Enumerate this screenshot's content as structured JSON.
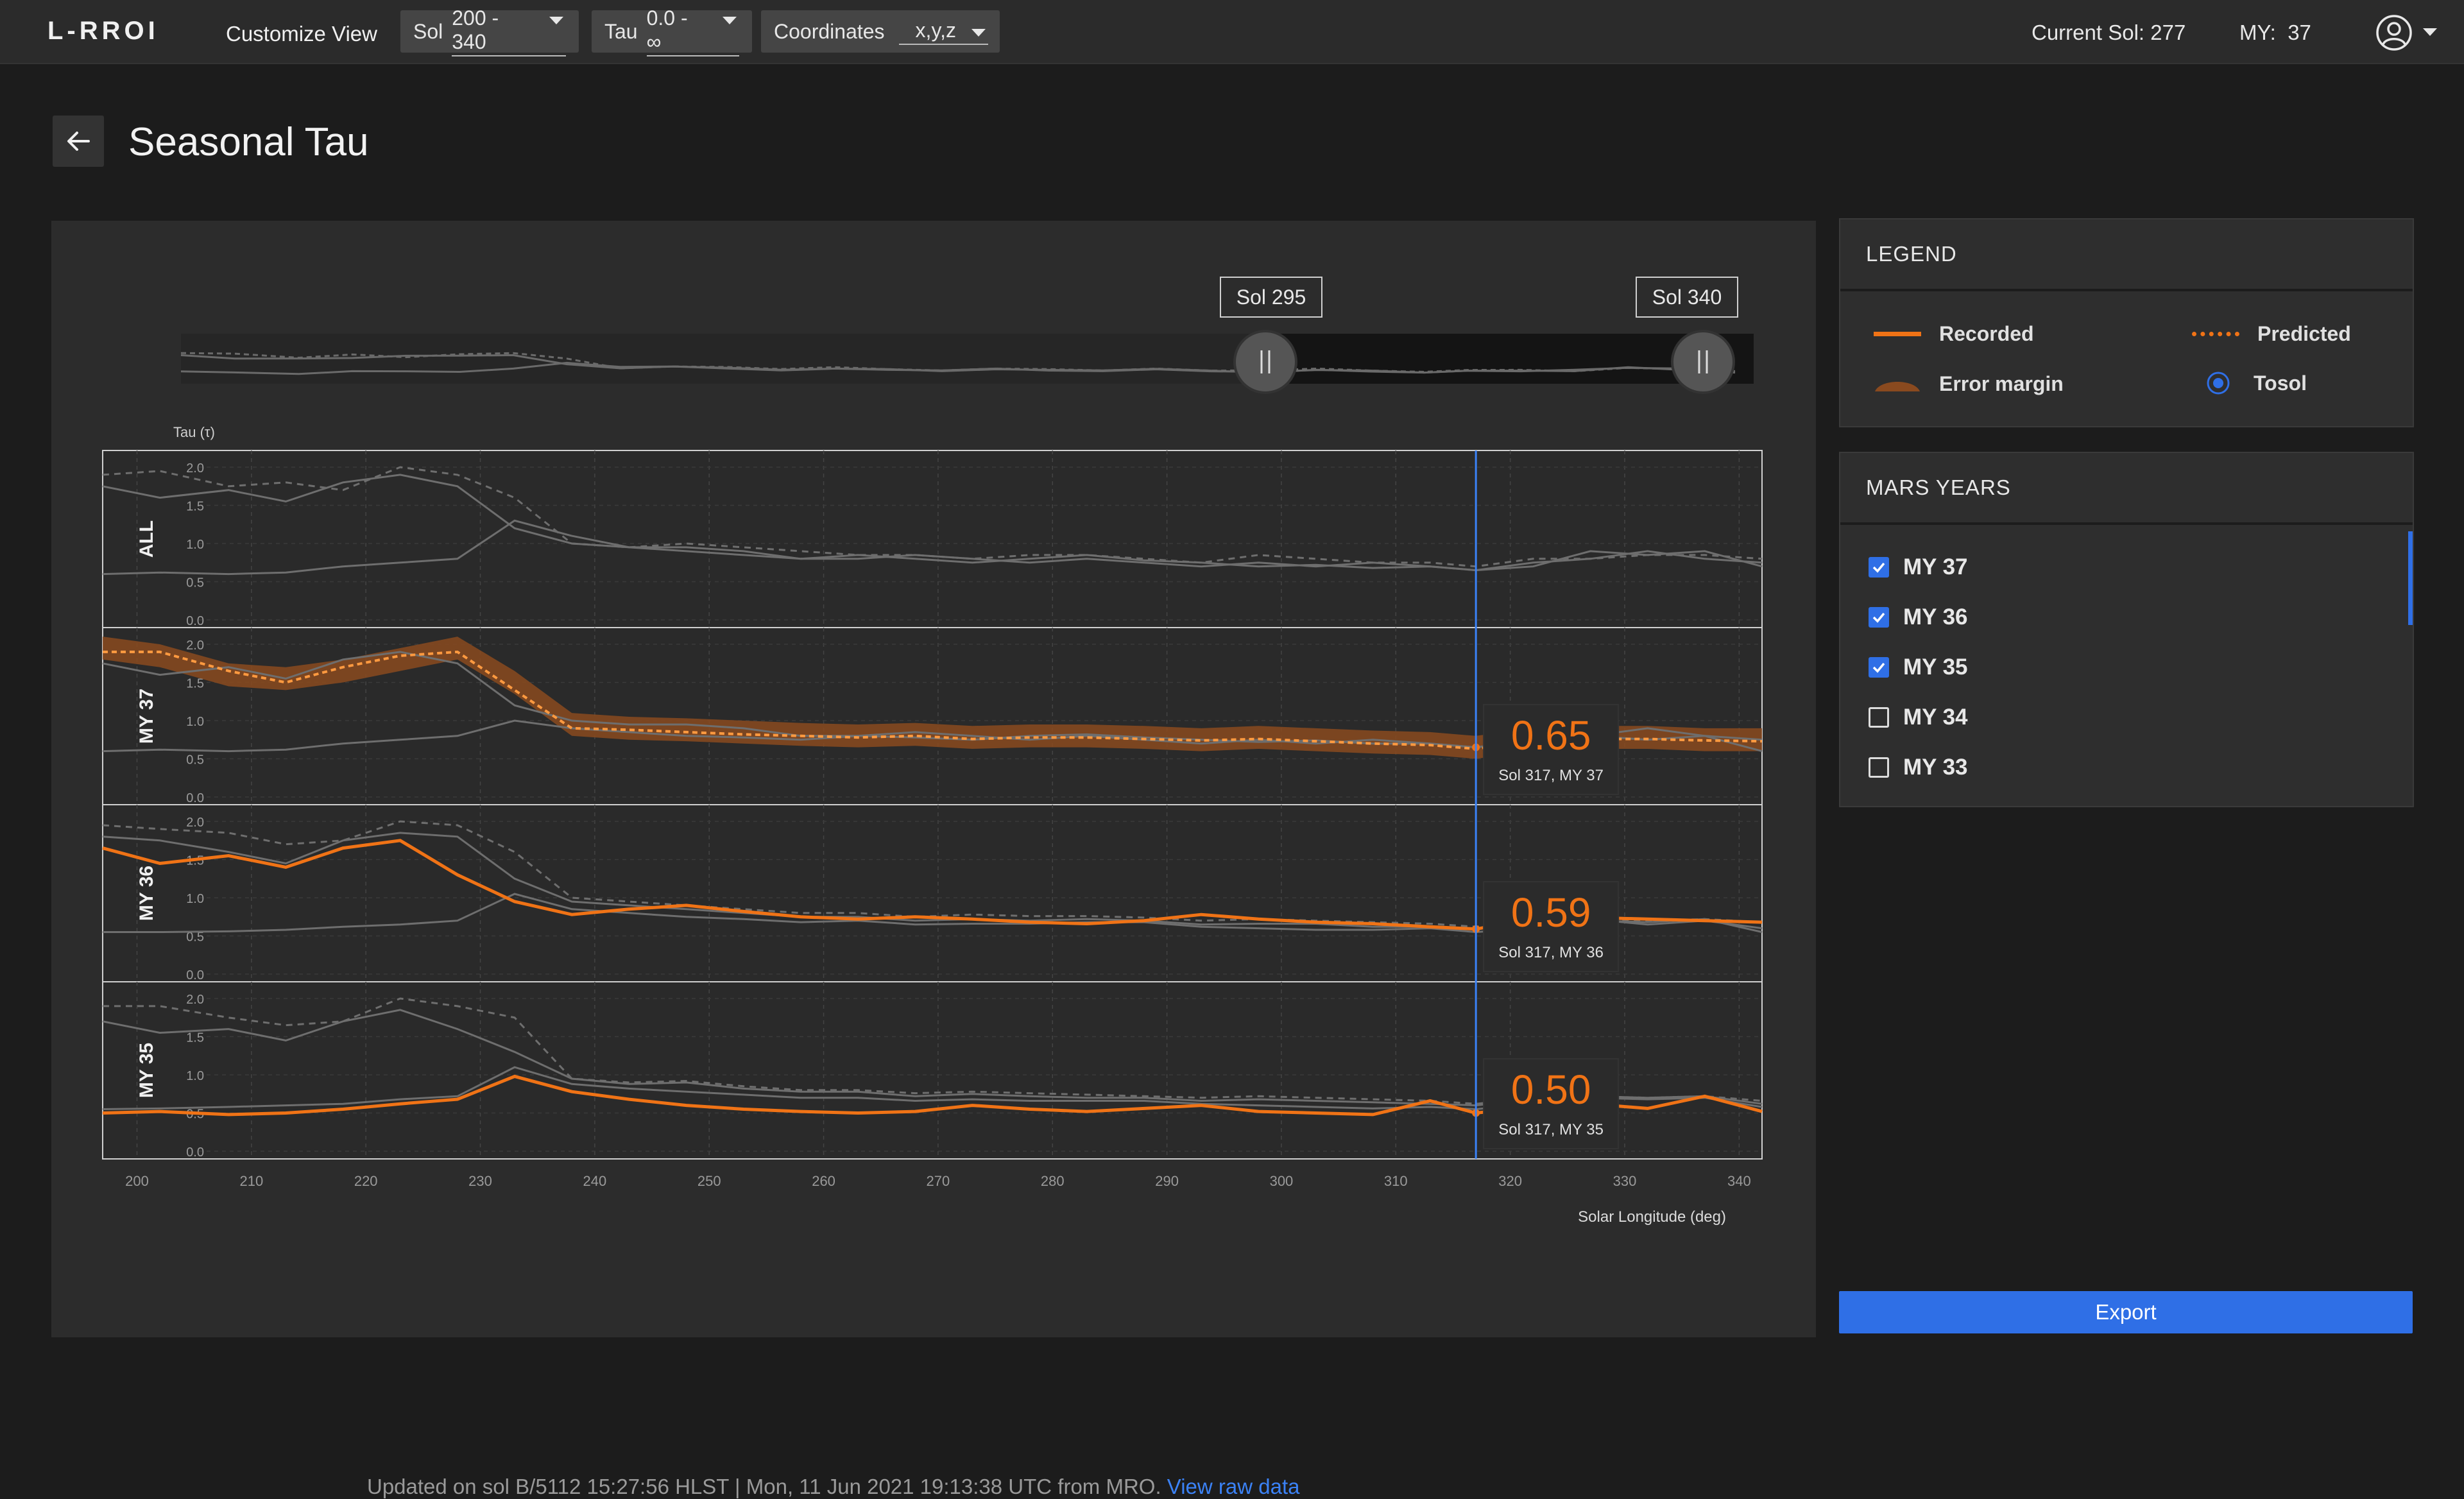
{
  "app": {
    "name": "L-RROI",
    "customize_label": "Customize View"
  },
  "filters": {
    "sol": {
      "label": "Sol",
      "value": "200 - 340"
    },
    "tau": {
      "label": "Tau",
      "value": "0.0 - ∞"
    },
    "coords": {
      "label": "Coordinates",
      "value": "x,y,z"
    }
  },
  "status": {
    "current_sol_label": "Current Sol:",
    "current_sol": "277",
    "my_label": "MY:",
    "my": "37"
  },
  "page": {
    "title": "Seasonal Tau"
  },
  "range": {
    "start": "Sol 295",
    "end": "Sol 340"
  },
  "legend": {
    "title": "LEGEND",
    "recorded": "Recorded",
    "predicted": "Predicted",
    "error": "Error margin",
    "tosol": "Tosol"
  },
  "mars_years": {
    "title": "MARS YEARS",
    "items": [
      {
        "label": "MY 37",
        "checked": true
      },
      {
        "label": "MY 36",
        "checked": true
      },
      {
        "label": "MY 35",
        "checked": true
      },
      {
        "label": "MY 34",
        "checked": false
      },
      {
        "label": "MY 33",
        "checked": false
      }
    ]
  },
  "footer": {
    "text": "Updated on sol B/5112 15:27:56 HLST | Mon, 11 Jun 2021 19:13:38 UTC from MRO.",
    "link": "View raw data"
  },
  "export_label": "Export",
  "colors": {
    "recorded": "#f07316",
    "error": "#8a4a1f",
    "cursor": "#3b82f6",
    "accent": "#2f6fe6"
  },
  "chart_data": {
    "type": "line",
    "ylabel": "Tau (τ)",
    "xlabel": "Solar Longitude (deg)",
    "x_ticks": [
      200,
      210,
      220,
      230,
      240,
      250,
      260,
      270,
      280,
      290,
      300,
      310,
      320,
      330,
      340
    ],
    "y_ticks": [
      "2.0",
      "1.5",
      "1.0",
      "0.5",
      "0.0"
    ],
    "ylim": [
      0,
      2
    ],
    "xlim": [
      197,
      342
    ],
    "cursor_x": 317,
    "x": [
      197,
      202,
      208,
      213,
      218,
      223,
      228,
      233,
      238,
      243,
      248,
      253,
      258,
      263,
      268,
      273,
      278,
      283,
      288,
      293,
      298,
      303,
      308,
      313,
      317,
      322,
      327,
      332,
      337,
      342
    ],
    "panels": [
      {
        "label": "ALL",
        "tooltip": null,
        "gray_a": [
          1.75,
          1.6,
          1.7,
          1.55,
          1.8,
          1.9,
          1.75,
          1.2,
          1.0,
          0.95,
          0.95,
          0.9,
          0.8,
          0.8,
          0.85,
          0.8,
          0.75,
          0.8,
          0.75,
          0.7,
          0.75,
          0.7,
          0.75,
          0.7,
          0.65,
          0.75,
          0.8,
          0.9,
          0.8,
          0.75
        ],
        "gray_b": [
          0.6,
          0.62,
          0.6,
          0.62,
          0.7,
          0.75,
          0.8,
          1.3,
          1.1,
          0.95,
          0.9,
          0.85,
          0.8,
          0.85,
          0.8,
          0.75,
          0.8,
          0.85,
          0.78,
          0.75,
          0.7,
          0.72,
          0.68,
          0.7,
          0.65,
          0.7,
          0.9,
          0.85,
          0.9,
          0.7
        ],
        "dashed": [
          1.9,
          1.95,
          1.75,
          1.8,
          1.7,
          2.0,
          1.9,
          1.6,
          1.0,
          0.95,
          1.0,
          0.95,
          0.9,
          0.85,
          0.85,
          0.8,
          0.85,
          0.85,
          0.8,
          0.75,
          0.85,
          0.8,
          0.75,
          0.75,
          0.7,
          0.8,
          0.8,
          0.85,
          0.85,
          0.8
        ],
        "recorded": null,
        "predicted": null
      },
      {
        "label": "MY 37",
        "tooltip": {
          "value": "0.65",
          "caption": "Sol 317, MY 37"
        },
        "gray_a": [
          1.75,
          1.6,
          1.7,
          1.55,
          1.8,
          1.9,
          1.75,
          1.2,
          1.0,
          0.95,
          0.95,
          0.9,
          0.8,
          0.8,
          0.85,
          0.8,
          0.75,
          0.8,
          0.75,
          0.7,
          0.75,
          0.7,
          0.75,
          0.7,
          0.65,
          0.75,
          0.8,
          0.9,
          0.8,
          0.75
        ],
        "gray_b": [
          0.6,
          0.62,
          0.6,
          0.62,
          0.7,
          0.75,
          0.8,
          1.0,
          0.9,
          0.85,
          0.8,
          0.78,
          0.75,
          0.8,
          0.78,
          0.75,
          0.8,
          0.82,
          0.78,
          0.75,
          0.72,
          0.74,
          0.7,
          0.7,
          0.65,
          0.72,
          0.8,
          0.75,
          0.8,
          0.6
        ],
        "recorded": [
          1.95,
          1.85,
          1.6,
          1.55,
          1.65,
          1.8,
          1.95,
          1.5,
          0.95,
          0.9,
          0.88,
          0.85,
          0.82,
          0.8,
          0.82,
          0.78,
          0.8,
          0.8,
          0.78,
          0.75,
          0.78,
          0.75,
          0.72,
          0.7,
          0.65,
          0.75,
          0.78,
          0.78,
          0.75,
          0.75
        ],
        "predicted": [
          1.9,
          1.9,
          1.65,
          1.5,
          1.7,
          1.85,
          1.9,
          1.4,
          0.9,
          0.88,
          0.85,
          0.82,
          0.8,
          0.78,
          0.8,
          0.76,
          0.78,
          0.78,
          0.76,
          0.74,
          0.76,
          0.73,
          0.7,
          0.68,
          0.63,
          0.73,
          0.76,
          0.76,
          0.74,
          0.73
        ],
        "error": 0.15
      },
      {
        "label": "MY 36",
        "tooltip": {
          "value": "0.59",
          "caption": "Sol 317, MY 36"
        },
        "gray_a": [
          1.8,
          1.75,
          1.6,
          1.45,
          1.75,
          1.85,
          1.8,
          1.25,
          0.95,
          0.9,
          0.85,
          0.8,
          0.75,
          0.75,
          0.7,
          0.72,
          0.7,
          0.72,
          0.7,
          0.65,
          0.66,
          0.66,
          0.62,
          0.62,
          0.6,
          0.68,
          0.72,
          0.65,
          0.7,
          0.6
        ],
        "gray_b": [
          0.55,
          0.55,
          0.56,
          0.58,
          0.62,
          0.65,
          0.7,
          1.05,
          0.85,
          0.8,
          0.75,
          0.72,
          0.68,
          0.7,
          0.65,
          0.66,
          0.66,
          0.68,
          0.68,
          0.62,
          0.6,
          0.58,
          0.58,
          0.6,
          0.55,
          0.6,
          0.7,
          0.68,
          0.72,
          0.55
        ],
        "dashed": [
          1.95,
          1.9,
          1.85,
          1.7,
          1.75,
          2.0,
          1.95,
          1.6,
          1.0,
          0.95,
          0.9,
          0.85,
          0.8,
          0.8,
          0.75,
          0.78,
          0.76,
          0.76,
          0.74,
          0.7,
          0.72,
          0.7,
          0.68,
          0.66,
          0.62,
          0.7,
          0.72,
          0.7,
          0.72,
          0.68
        ],
        "recorded": [
          1.65,
          1.45,
          1.55,
          1.4,
          1.65,
          1.75,
          1.3,
          0.95,
          0.78,
          0.85,
          0.9,
          0.82,
          0.75,
          0.72,
          0.75,
          0.72,
          0.68,
          0.66,
          0.7,
          0.78,
          0.72,
          0.68,
          0.66,
          0.62,
          0.59,
          0.72,
          0.74,
          0.72,
          0.7,
          0.68
        ],
        "predicted": null
      },
      {
        "label": "MY 35",
        "tooltip": {
          "value": "0.50",
          "caption": "Sol 317, MY 35"
        },
        "gray_a": [
          1.7,
          1.55,
          1.6,
          1.45,
          1.7,
          1.85,
          1.6,
          1.3,
          0.95,
          0.88,
          0.9,
          0.82,
          0.78,
          0.78,
          0.72,
          0.75,
          0.72,
          0.7,
          0.7,
          0.66,
          0.68,
          0.66,
          0.64,
          0.62,
          0.6,
          0.68,
          0.72,
          0.7,
          0.72,
          0.62
        ],
        "gray_b": [
          0.55,
          0.56,
          0.58,
          0.6,
          0.62,
          0.68,
          0.72,
          1.1,
          0.88,
          0.82,
          0.78,
          0.74,
          0.7,
          0.7,
          0.66,
          0.68,
          0.66,
          0.66,
          0.66,
          0.62,
          0.6,
          0.58,
          0.56,
          0.58,
          0.55,
          0.62,
          0.7,
          0.68,
          0.7,
          0.58
        ],
        "dashed": [
          1.9,
          1.9,
          1.75,
          1.65,
          1.7,
          2.0,
          1.9,
          1.75,
          0.95,
          0.9,
          0.92,
          0.85,
          0.8,
          0.8,
          0.76,
          0.78,
          0.76,
          0.74,
          0.72,
          0.7,
          0.72,
          0.7,
          0.68,
          0.66,
          0.62,
          0.7,
          0.72,
          0.7,
          0.72,
          0.66
        ],
        "recorded": [
          0.5,
          0.52,
          0.48,
          0.5,
          0.55,
          0.62,
          0.68,
          0.98,
          0.78,
          0.68,
          0.6,
          0.55,
          0.52,
          0.5,
          0.52,
          0.6,
          0.55,
          0.52,
          0.56,
          0.6,
          0.52,
          0.5,
          0.48,
          0.66,
          0.5,
          0.58,
          0.62,
          0.56,
          0.72,
          0.52
        ],
        "predicted": null
      }
    ]
  }
}
